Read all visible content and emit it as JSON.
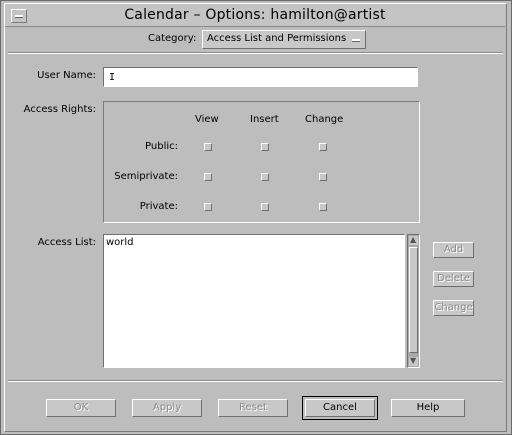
{
  "window": {
    "title": "Calendar – Options: hamilton@artist"
  },
  "category": {
    "label": "Category:",
    "value": "Access List and Permissions"
  },
  "user_name": {
    "label": "User Name:",
    "value": ""
  },
  "access_rights": {
    "label": "Access Rights:",
    "columns": [
      "View",
      "Insert",
      "Change"
    ],
    "rows": [
      {
        "label": "Public:",
        "checked": [
          false,
          false,
          false
        ]
      },
      {
        "label": "Semiprivate:",
        "checked": [
          false,
          false,
          false
        ]
      },
      {
        "label": "Private:",
        "checked": [
          false,
          false,
          false
        ]
      }
    ]
  },
  "access_list": {
    "label": "Access List:",
    "items": [
      "world"
    ]
  },
  "side_buttons": {
    "add": "Add",
    "delete": "Delete",
    "change": "Change"
  },
  "bottom_buttons": {
    "ok": "OK",
    "apply": "Apply",
    "reset": "Reset",
    "cancel": "Cancel",
    "help": "Help"
  },
  "icons": {
    "window_menu": "window-menu-icon",
    "dropdown": "dropdown-indicator-icon"
  }
}
